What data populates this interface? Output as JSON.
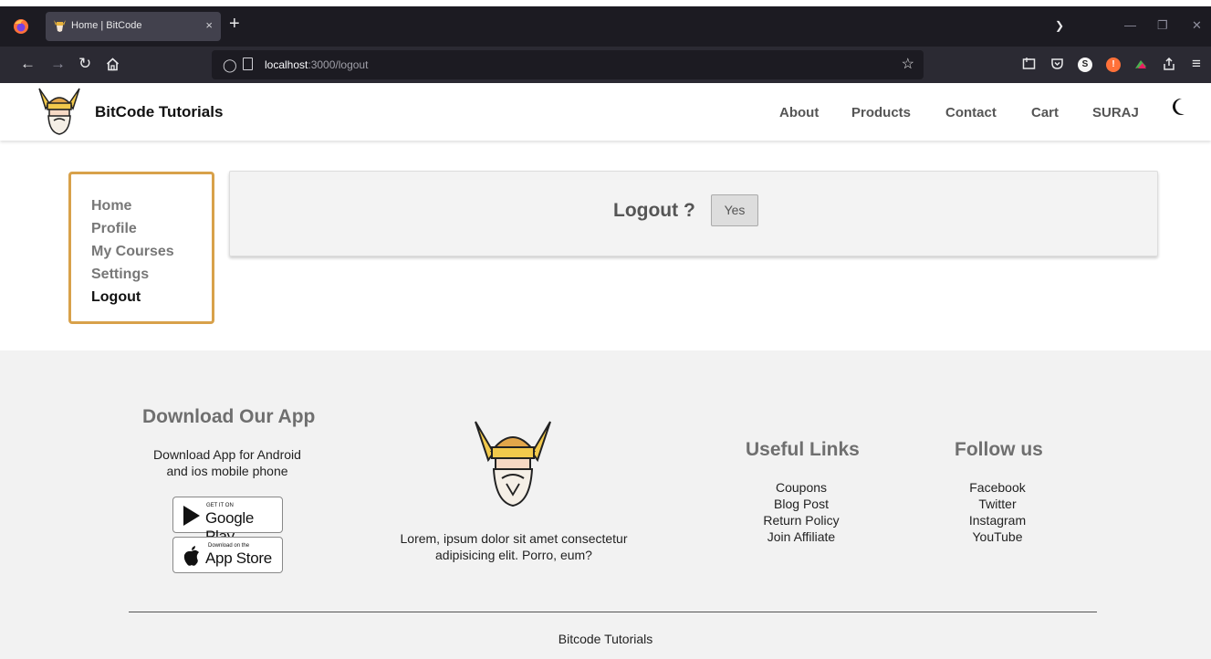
{
  "browser": {
    "tab_title": "Home | BitCode",
    "tab_close": "×",
    "new_tab": "+",
    "url_host": "localhost",
    "url_rest": ":3000/logout"
  },
  "header": {
    "brand": "BitCode Tutorials",
    "nav": [
      "About",
      "Products",
      "Contact",
      "Cart",
      "SURAJ"
    ]
  },
  "sidebar": {
    "items": [
      {
        "label": "Home",
        "active": false
      },
      {
        "label": "Profile",
        "active": false
      },
      {
        "label": "My Courses",
        "active": false
      },
      {
        "label": "Settings",
        "active": false
      },
      {
        "label": "Logout",
        "active": true
      }
    ]
  },
  "logout": {
    "question": "Logout ?",
    "confirm_label": "Yes"
  },
  "footer": {
    "app_heading": "Download Our App",
    "app_text_1": "Download App for Android",
    "app_text_2": "and ios mobile phone",
    "google_small": "GET IT ON",
    "google_big": "Google Play",
    "apple_small": "Download on the",
    "apple_big": "App Store",
    "lorem_1": "Lorem, ipsum dolor sit amet consectetur",
    "lorem_2": "adipisicing elit. Porro, eum?",
    "useful_heading": "Useful Links",
    "useful_links": [
      "Coupons",
      "Blog Post",
      "Return Policy",
      "Join Affiliate"
    ],
    "follow_heading": "Follow us",
    "follow_links": [
      "Facebook",
      "Twitter",
      "Instagram",
      "YouTube"
    ],
    "copyright": "Bitcode Tutorials"
  },
  "colors": {
    "sidebar_border": "#d8a14a",
    "footer_bg": "#f2f2f2",
    "browser_dark": "#1c1b22"
  },
  "icons": [
    "firefox-icon",
    "back-icon",
    "forward-icon",
    "reload-icon",
    "home-icon",
    "shield-icon",
    "page-icon",
    "bookmark-star-icon",
    "moon-icon",
    "google-play-icon",
    "apple-icon",
    "viking-logo"
  ]
}
